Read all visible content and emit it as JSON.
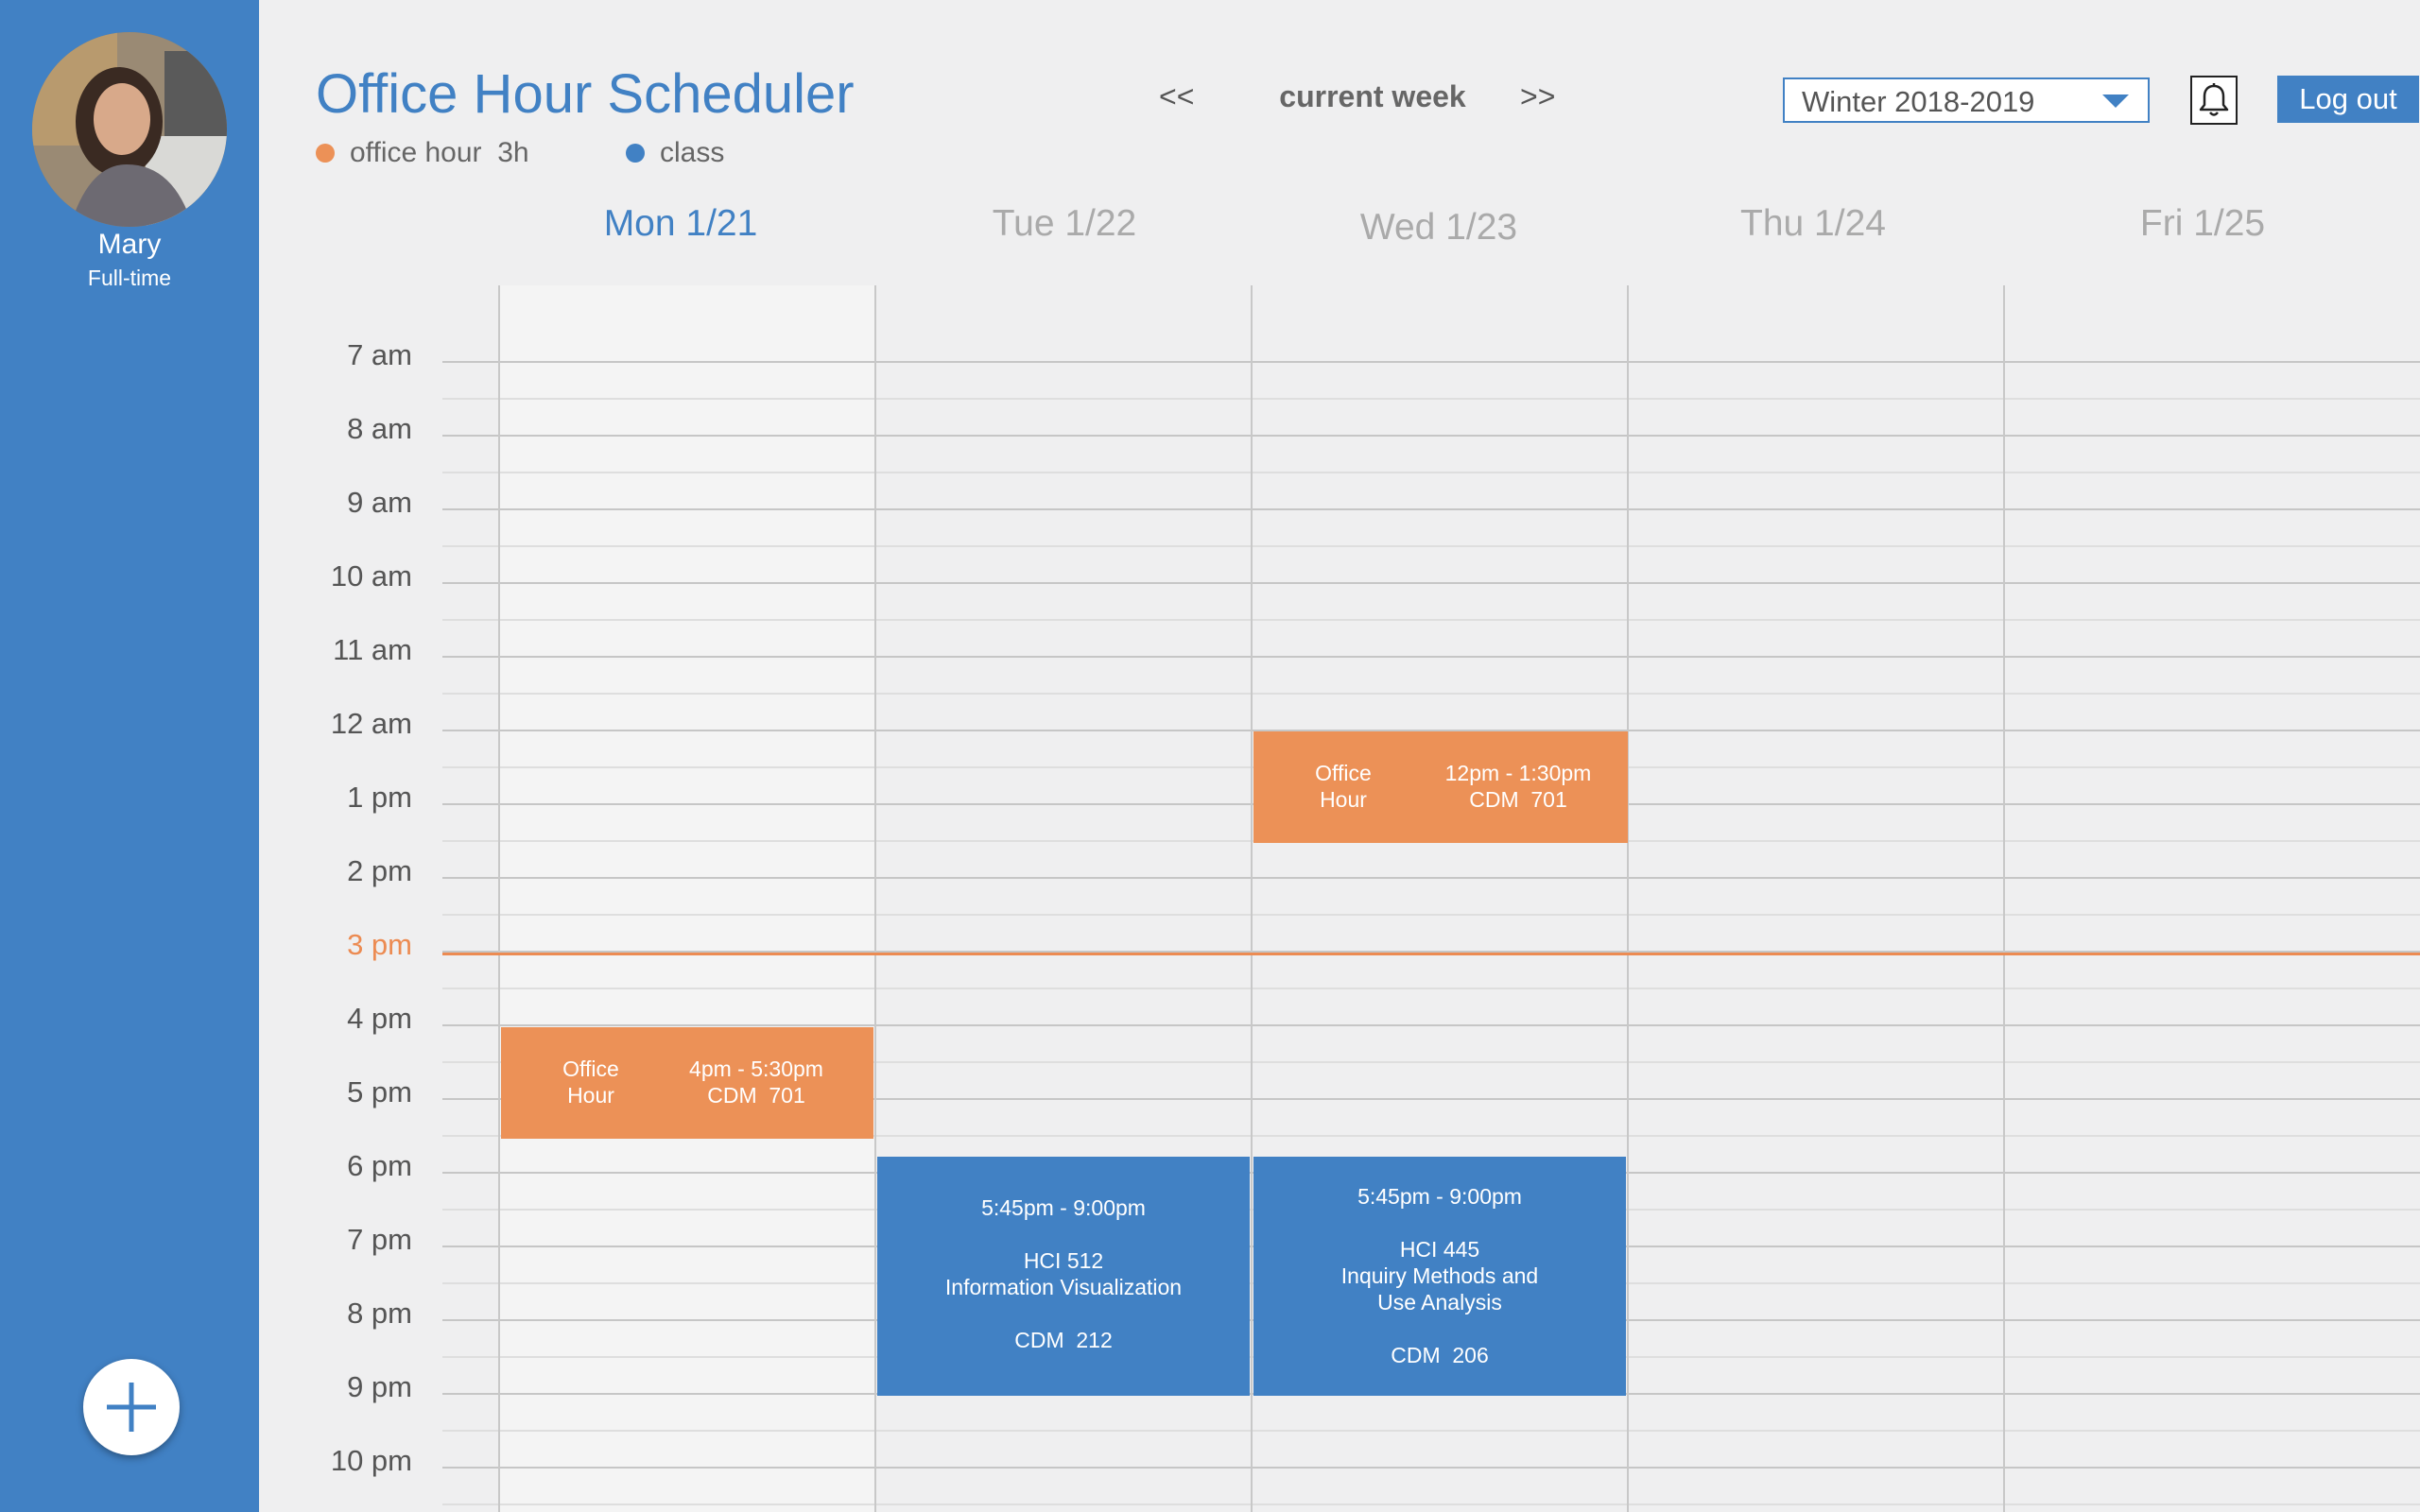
{
  "user": {
    "name": "Mary",
    "role": "Full-time"
  },
  "app": {
    "title": "Office Hour Scheduler"
  },
  "legend": {
    "office_label": "office hour  3h",
    "class_label": "class"
  },
  "colors": {
    "accent": "#4181c4",
    "office": "#ec9157",
    "class": "#4181c4",
    "now": "#ec8b52"
  },
  "week_nav": {
    "prev": "<<",
    "label": "current week",
    "next": ">>"
  },
  "term_select": {
    "value": "Winter 2018-2019"
  },
  "icons": {
    "notifications": "bell-icon",
    "add": "plus-icon",
    "dropdown": "caret-down-icon"
  },
  "logout_label": "Log out",
  "days": [
    {
      "label": "Mon 1/21"
    },
    {
      "label": "Tue 1/22"
    },
    {
      "label": "Wed 1/23"
    },
    {
      "label": "Thu 1/24"
    },
    {
      "label": "Fri 1/25"
    }
  ],
  "times": [
    "7 am",
    "8 am",
    "9 am",
    "10 am",
    "11 am",
    "12 am",
    "1 pm",
    "2 pm",
    "3 pm",
    "4 pm",
    "5 pm",
    "6 pm",
    "7 pm",
    "8 pm",
    "9 pm",
    "10 pm"
  ],
  "current_time_label": "3 pm",
  "events": {
    "mon_office": {
      "type": "office hour",
      "line1": "Office",
      "line2": "Hour",
      "time": "4pm - 5:30pm",
      "room": "CDM  701"
    },
    "wed_office": {
      "type": "office hour",
      "line1": "Office",
      "line2": "Hour",
      "time": "12pm - 1:30pm",
      "room": "CDM  701"
    },
    "tue_class": {
      "type": "class",
      "time": "5:45pm - 9:00pm",
      "code": "HCI 512",
      "title1": "Information Visualization",
      "room": "CDM  212"
    },
    "wed_class": {
      "type": "class",
      "time": "5:45pm - 9:00pm",
      "code": "HCI 445",
      "title1": "Inquiry Methods and",
      "title2": "Use Analysis",
      "room": "CDM  206"
    }
  }
}
